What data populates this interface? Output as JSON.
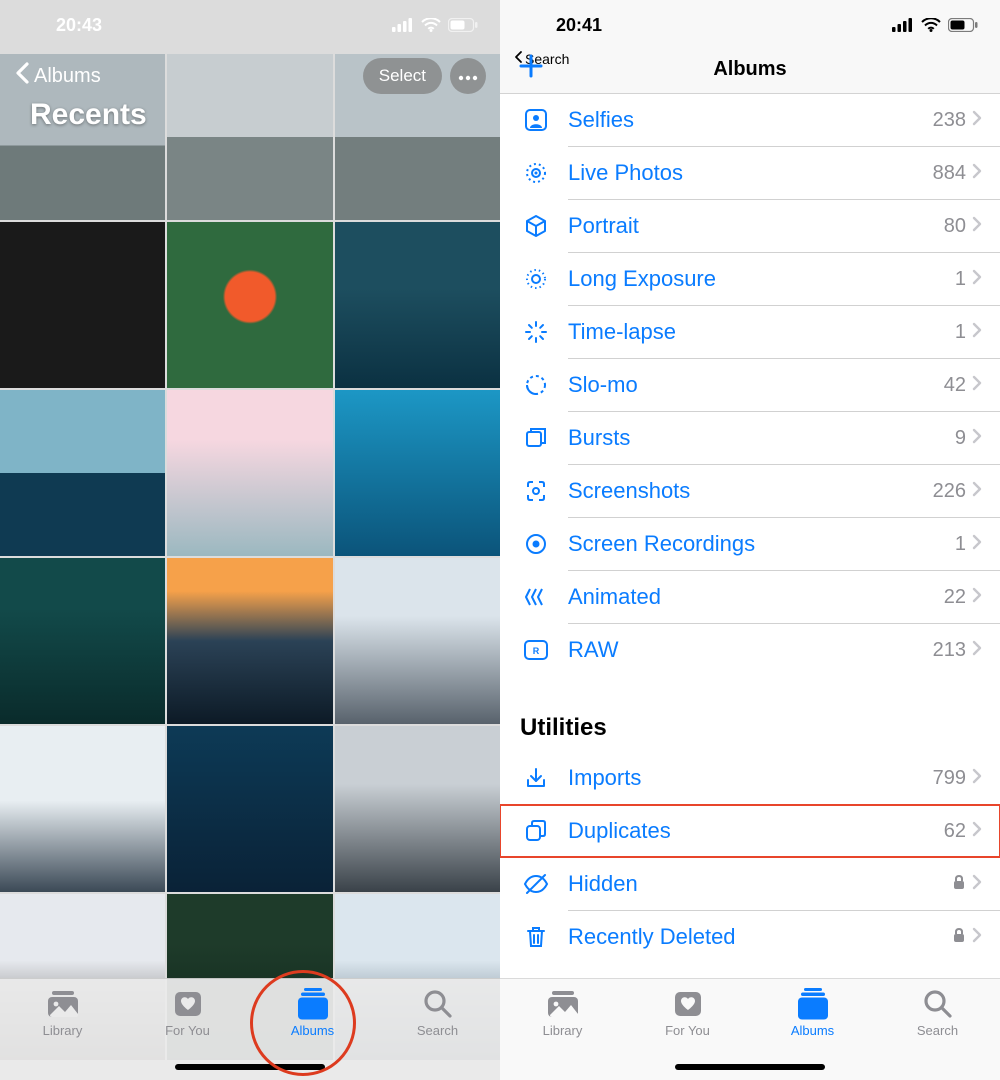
{
  "colors": {
    "accent": "#0a7cff",
    "annotation": "#dd3b1f"
  },
  "left": {
    "status": {
      "time": "20:43"
    },
    "back_label": "Albums",
    "title": "Recents",
    "select_label": "Select",
    "tabs": [
      {
        "id": "library",
        "label": "Library"
      },
      {
        "id": "foryou",
        "label": "For You"
      },
      {
        "id": "albums",
        "label": "Albums"
      },
      {
        "id": "search",
        "label": "Search"
      }
    ],
    "active_tab": "albums"
  },
  "right": {
    "status": {
      "time": "20:41"
    },
    "back_breadcrumb": "Search",
    "title": "Albums",
    "media_types": [
      {
        "icon": "person-square-icon",
        "label": "Selfies",
        "count": 238
      },
      {
        "icon": "live-photo-icon",
        "label": "Live Photos",
        "count": 884
      },
      {
        "icon": "cube-icon",
        "label": "Portrait",
        "count": 80
      },
      {
        "icon": "long-exposure-icon",
        "label": "Long Exposure",
        "count": 1
      },
      {
        "icon": "timelapse-icon",
        "label": "Time-lapse",
        "count": 1
      },
      {
        "icon": "slomo-icon",
        "label": "Slo-mo",
        "count": 42
      },
      {
        "icon": "bursts-icon",
        "label": "Bursts",
        "count": 9
      },
      {
        "icon": "screenshot-icon",
        "label": "Screenshots",
        "count": 226
      },
      {
        "icon": "record-icon",
        "label": "Screen Recordings",
        "count": 1
      },
      {
        "icon": "animated-icon",
        "label": "Animated",
        "count": 22
      },
      {
        "icon": "raw-icon",
        "label": "RAW",
        "count": 213
      }
    ],
    "utilities_header": "Utilities",
    "utilities": [
      {
        "icon": "import-icon",
        "label": "Imports",
        "count": 799,
        "locked": false
      },
      {
        "icon": "duplicate-icon",
        "label": "Duplicates",
        "count": 62,
        "locked": false,
        "highlighted": true
      },
      {
        "icon": "hidden-icon",
        "label": "Hidden",
        "count": null,
        "locked": true
      },
      {
        "icon": "trash-icon",
        "label": "Recently Deleted",
        "count": null,
        "locked": true
      }
    ],
    "tabs": [
      {
        "id": "library",
        "label": "Library"
      },
      {
        "id": "foryou",
        "label": "For You"
      },
      {
        "id": "albums",
        "label": "Albums"
      },
      {
        "id": "search",
        "label": "Search"
      }
    ],
    "active_tab": "albums"
  }
}
